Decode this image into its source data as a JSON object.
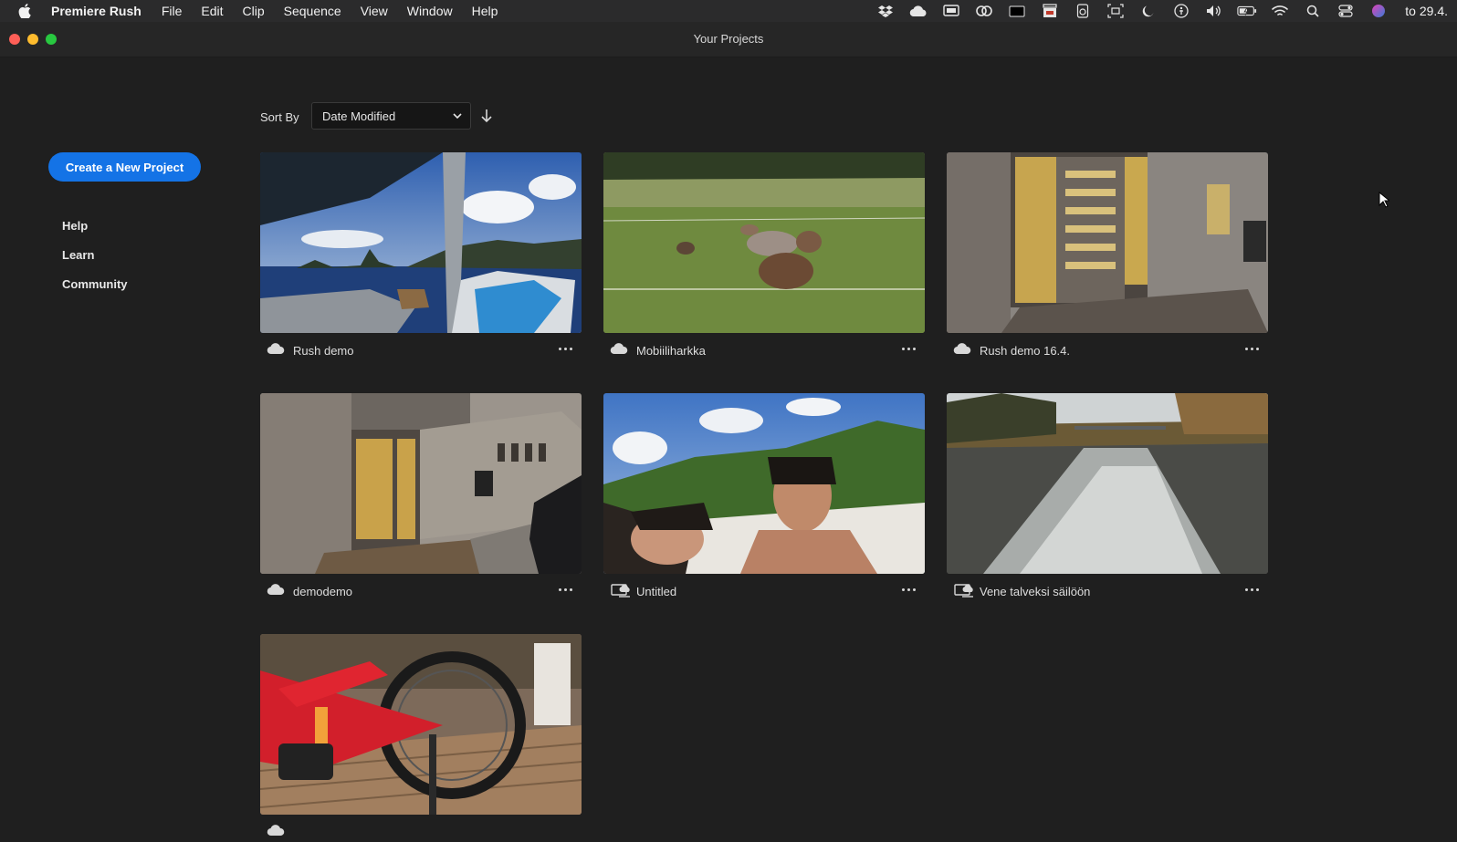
{
  "menubar": {
    "app_name": "Premiere Rush",
    "items": [
      "File",
      "Edit",
      "Clip",
      "Sequence",
      "View",
      "Window",
      "Help"
    ],
    "clock": "to 29.4."
  },
  "window": {
    "title": "Your Projects"
  },
  "sidebar": {
    "create_label": "Create a New Project",
    "links": [
      "Help",
      "Learn",
      "Community"
    ]
  },
  "sort": {
    "label": "Sort By",
    "selected": "Date Modified",
    "direction": "descending"
  },
  "projects": [
    {
      "name": "Rush demo",
      "sync_icon": "cloud-icon",
      "thumbnail": "boat-sea-cliffs"
    },
    {
      "name": "Mobiiliharkka",
      "sync_icon": "cloud-icon",
      "thumbnail": "sheep-field"
    },
    {
      "name": "Rush demo 16.4.",
      "sync_icon": "cloud-icon",
      "thumbnail": "building-door"
    },
    {
      "name": "demodemo",
      "sync_icon": "cloud-icon",
      "thumbnail": "building-street"
    },
    {
      "name": "Untitled",
      "sync_icon": "cloud-sync-icon",
      "thumbnail": "beach-selfie"
    },
    {
      "name": "Vene talveksi säilöön",
      "sync_icon": "cloud-sync-icon",
      "thumbnail": "boat-wake-river"
    },
    {
      "name": "",
      "sync_icon": "cloud-icon",
      "thumbnail": "red-bicycle"
    }
  ],
  "colors": {
    "accent": "#1473e6",
    "background": "#1f1f1f"
  }
}
